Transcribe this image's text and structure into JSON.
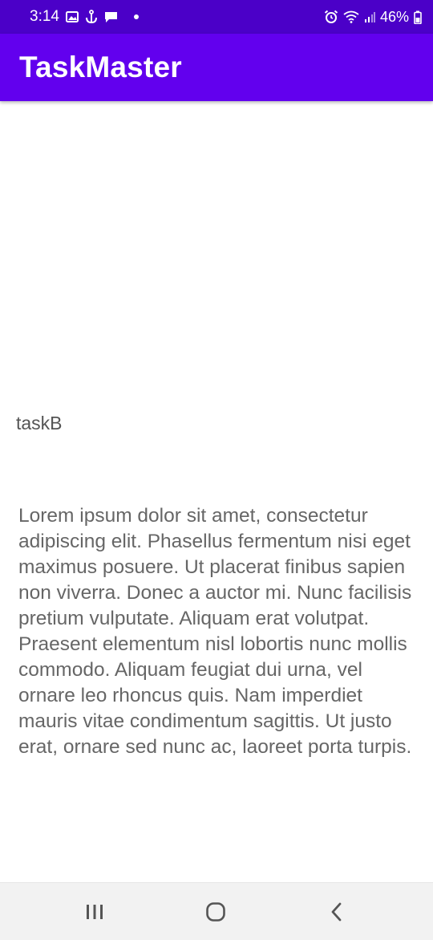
{
  "status_bar": {
    "time": "3:14",
    "battery": "46%",
    "left_icons": [
      "gallery-icon",
      "anchor-icon",
      "message-icon",
      "dot-icon"
    ],
    "right_icons": [
      "alarm-icon",
      "wifi-icon",
      "signal-icon",
      "battery-icon"
    ]
  },
  "app_bar": {
    "title": "TaskMaster"
  },
  "task": {
    "title": "taskB",
    "body": "Lorem ipsum dolor sit amet, consectetur adipiscing elit. Phasellus fermentum nisi eget maximus posuere. Ut placerat finibus sapien non viverra. Donec a auctor mi. Nunc facilisis pretium vulputate. Aliquam erat volutpat. Praesent elementum nisl lobortis nunc mollis commodo. Aliquam feugiat dui urna, vel ornare leo rhoncus quis. Nam imperdiet mauris vitae condimentum sagittis. Ut justo erat, ornare sed nunc ac, laoreet porta turpis."
  },
  "nav_bar": {
    "buttons": [
      "recents-icon",
      "home-icon",
      "back-icon"
    ]
  },
  "colors": {
    "status_bar": "#4B00C8",
    "app_bar": "#6200EE",
    "title_text": "#555555",
    "body_text": "#666666",
    "nav_bar": "#f2f2f2"
  }
}
